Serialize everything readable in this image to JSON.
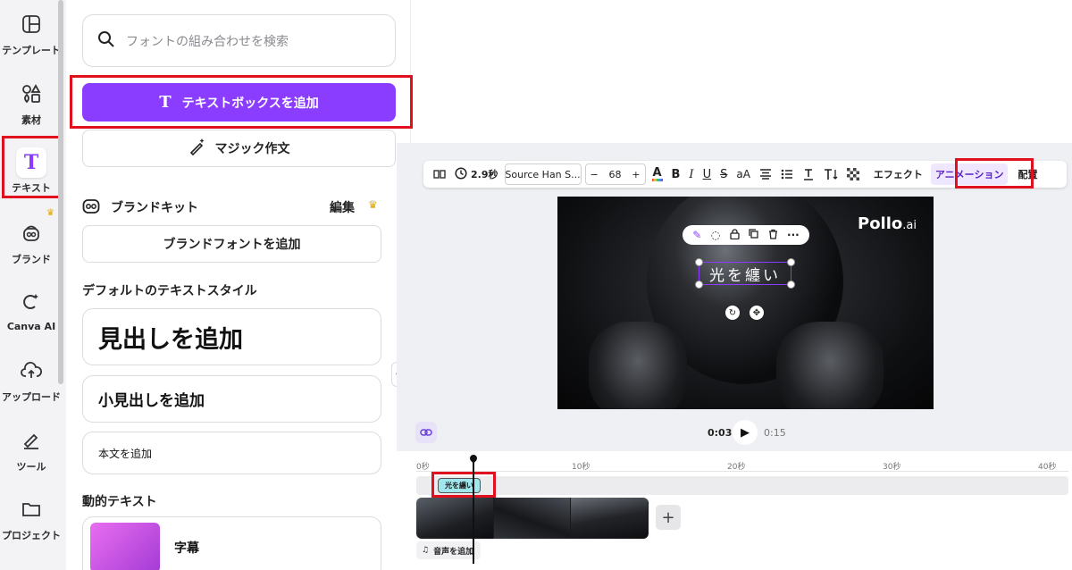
{
  "nav": {
    "items": [
      {
        "label": "テンプレート",
        "icon": "template-icon"
      },
      {
        "label": "素材",
        "icon": "elements-icon"
      },
      {
        "label": "テキスト",
        "icon": "text-icon"
      },
      {
        "label": "ブランド",
        "icon": "brand-icon"
      },
      {
        "label": "Canva AI",
        "icon": "canva-ai-icon"
      },
      {
        "label": "アップロード",
        "icon": "upload-icon"
      },
      {
        "label": "ツール",
        "icon": "tools-icon"
      },
      {
        "label": "プロジェクト",
        "icon": "folder-icon"
      }
    ]
  },
  "panel": {
    "search_placeholder": "フォントの組み合わせを検索",
    "add_textbox": "テキストボックスを追加",
    "magic_write": "マジック作文",
    "brand_kit": "ブランドキット",
    "edit": "編集",
    "add_brand_font": "ブランドフォントを追加",
    "default_styles_title": "デフォルトのテキストスタイル",
    "add_heading": "見出しを追加",
    "add_subheading": "小見出しを追加",
    "add_body": "本文を追加",
    "dynamic_text_title": "動的テキスト",
    "subtitle_item": "字幕"
  },
  "toolbar": {
    "duration": "2.9秒",
    "font": "Source Han S...",
    "minus": "−",
    "size": "68",
    "plus": "+",
    "color_letter": "A",
    "bold": "B",
    "italic": "I",
    "underline": "U",
    "strike": "S",
    "case": "aA",
    "effects": "エフェクト",
    "animation": "アニメーション",
    "position": "配置"
  },
  "canvas": {
    "watermark": "Pollo",
    "watermark_suffix": ".ai",
    "selected_text": "光を纏い"
  },
  "player": {
    "current_time": "0:03",
    "total_time": "0:15"
  },
  "timeline": {
    "ticks": [
      "0秒",
      "10秒",
      "20秒",
      "30秒",
      "40秒"
    ],
    "text_clip": "光を纏い",
    "add_audio": "音声を追加"
  },
  "colors": {
    "accent": "#8b3dff",
    "highlight": "#e0101e"
  }
}
